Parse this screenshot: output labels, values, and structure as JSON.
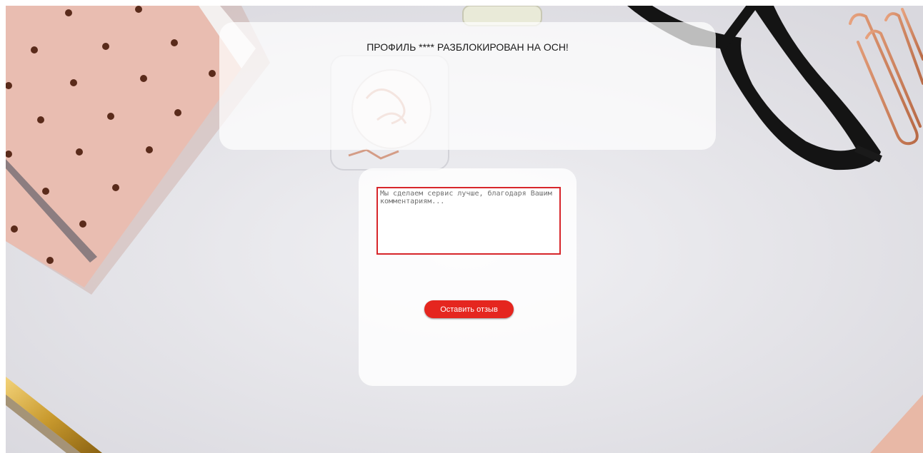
{
  "panel_top": {
    "headline": "ПРОФИЛЬ **** РАЗБЛОКИРОВАН НА ОСН!"
  },
  "feedback_form": {
    "comment_placeholder": "Мы сделаем сервис лучше, благодаря Вашим комментариям...",
    "comment_value": "",
    "submit_label": "Оставить отзыв"
  },
  "colors": {
    "accent": "#e5261f",
    "input_border": "#d7262b",
    "panel": "#ffffff",
    "background": "#e6e5ea"
  },
  "background_image": {
    "description_icons": [
      "notebook-icon",
      "glasses-icon",
      "paperclips-icon",
      "jar-icon",
      "pen-icon"
    ]
  }
}
